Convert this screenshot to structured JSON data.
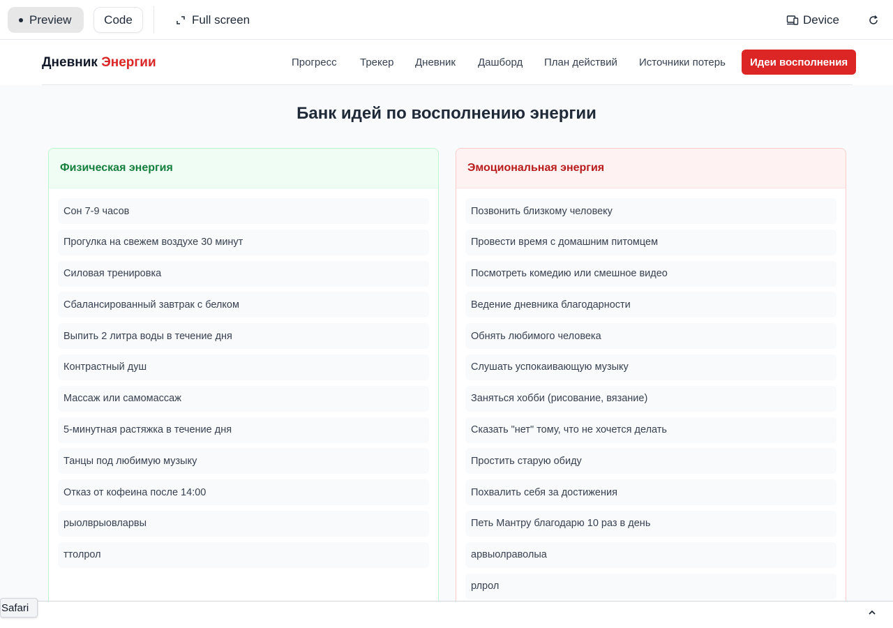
{
  "toolbar": {
    "preview_label": "Preview",
    "code_label": "Code",
    "fullscreen_label": "Full screen",
    "device_label": "Device"
  },
  "nav": {
    "brand_main": "Дневник",
    "brand_accent": "Энергии",
    "items": [
      "Прогресс",
      "Трекер",
      "Дневник",
      "Дашборд",
      "План действий",
      "Источники потерь"
    ],
    "active_item": "Идеи восполнения"
  },
  "page": {
    "title": "Банк идей по восполнению энергии"
  },
  "physical": {
    "title": "Физическая энергия",
    "ideas": [
      "Сон 7-9 часов",
      "Прогулка на свежем воздухе 30 минут",
      "Силовая тренировка",
      "Сбалансированный завтрак с белком",
      "Выпить 2 литра воды в течение дня",
      "Контрастный душ",
      "Массаж или самомассаж",
      "5-минутная растяжка в течение дня",
      "Танцы под любимую музыку",
      "Отказ от кофеина после 14:00",
      "рыолврыовларвы",
      "ттолрол"
    ]
  },
  "emotional": {
    "title": "Эмоциональная энергия",
    "ideas": [
      "Позвонить близкому человеку",
      "Провести время с домашним питомцем",
      "Посмотреть комедию или смешное видео",
      "Ведение дневника благодарности",
      "Обнять любимого человека",
      "Слушать успокаивающую музыку",
      "Заняться хобби (рисование, вязание)",
      "Сказать \"нет\" тому, что не хочется делать",
      "Простить старую обиду",
      "Похвалить себя за достижения",
      "Петь Мантру благодарю 10 раз в день",
      "арвыолраволыа",
      "рлрол"
    ]
  },
  "statusbar": {
    "tooltip": "Safari"
  },
  "colors": {
    "accent_red": "#dc2626",
    "physical_green": "#15803d",
    "emotional_red": "#b91c1c"
  }
}
